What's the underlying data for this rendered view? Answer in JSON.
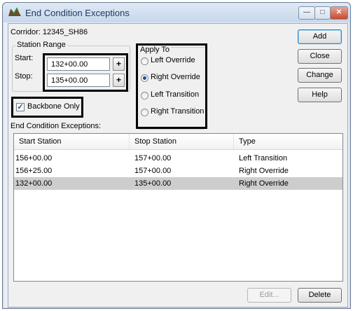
{
  "window": {
    "title": "End Condition Exceptions",
    "controls": [
      "minimize",
      "maximize",
      "close"
    ]
  },
  "corridor": {
    "label": "Corridor:",
    "value": "12345_SH86"
  },
  "station_range": {
    "group_label": "Station Range",
    "start_label": "Start:",
    "start_value": "132+00.00",
    "stop_label": "Stop:",
    "stop_value": "135+00.00",
    "picker_glyph": "+"
  },
  "apply_to": {
    "group_label": "Apply To",
    "options": [
      {
        "label": "Left Override",
        "selected": false
      },
      {
        "label": "Right Override",
        "selected": true
      },
      {
        "label": "Left Transition",
        "selected": false
      },
      {
        "label": "Right Transition",
        "selected": false
      }
    ]
  },
  "backbone": {
    "label": "Backbone Only",
    "checked": true
  },
  "buttons": {
    "add": "Add",
    "close": "Close",
    "change": "Change",
    "help": "Help",
    "edit": "Edit...",
    "delete": "Delete"
  },
  "exceptions": {
    "label": "End Condition Exceptions:",
    "columns": [
      "Start Station",
      "Stop Station",
      "Type"
    ],
    "rows": [
      [
        "156+00.00",
        "157+00.00",
        "Left Transition"
      ],
      [
        "156+25.00",
        "157+00.00",
        "Right Override"
      ],
      [
        "132+00.00",
        "135+00.00",
        "Right Override"
      ]
    ],
    "selected_row": 2
  },
  "colors": {
    "highlight_border": "#000000",
    "selected_row": "#cdcdcd",
    "title_text": "#1e395b"
  }
}
